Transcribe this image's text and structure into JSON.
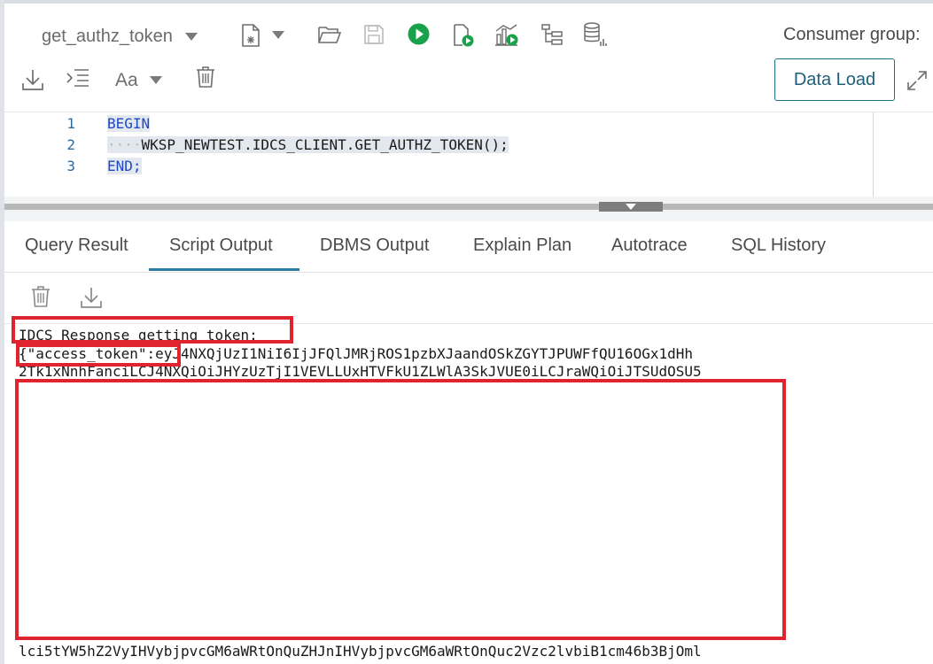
{
  "toolbar": {
    "script_name": "get_authz_token",
    "consumer_group_label": "Consumer group:",
    "data_load_label": "Data Load",
    "icons": {
      "dropdown": "chevron-down-icon",
      "new_script": "new-file-icon",
      "open": "folder-open-icon",
      "save": "save-icon",
      "run": "run-icon",
      "run_script": "run-script-icon",
      "autotrace": "autotrace-icon",
      "explain": "explain-plan-icon",
      "db": "database-icon",
      "download": "download-icon",
      "format": "format-icon",
      "case": "text-case-icon",
      "delete": "trash-icon",
      "expand": "expand-icon"
    }
  },
  "editor": {
    "lines": [
      {
        "num": "1",
        "text": "BEGIN"
      },
      {
        "num": "2",
        "text": "WKSP_NEWTEST.IDCS_CLIENT.GET_AUTHZ_TOKEN();"
      },
      {
        "num": "3",
        "text": "END;"
      }
    ]
  },
  "tabs": [
    "Query Result",
    "Script Output",
    "DBMS Output",
    "Explain Plan",
    "Autotrace",
    "SQL History"
  ],
  "active_tab": "Script Output",
  "output": {
    "line1": "IDCS Response getting token:",
    "line2_key": "{\"access_token\":",
    "line2_rest": "eyJ4NXQjUzI1NiI6IjJFQlJMRjROS1pzbXJaandOSkZGYTJPUWFfQU16OGx1dHh",
    "line3": "2Tk1xNnhFanciLCJ4NXQiOiJHYzUzTjI1VEVLLUxHTVFkU1ZLWlA3SkJVUE0iLCJraWQiOiJTSUdOSU5",
    "last_line": "lci5tYW5hZ2VyIHVybjpvcGM6aWRtOnQuZHJnIHVybjpvcGM6aWRtOnQuc2Vzc2lvbiB1cm46b3BjOml"
  },
  "colors": {
    "accent": "#2a7ea8",
    "run_green": "#1aa14b",
    "highlight_red": "#e0242f",
    "keyword_blue": "#1d49c4"
  }
}
